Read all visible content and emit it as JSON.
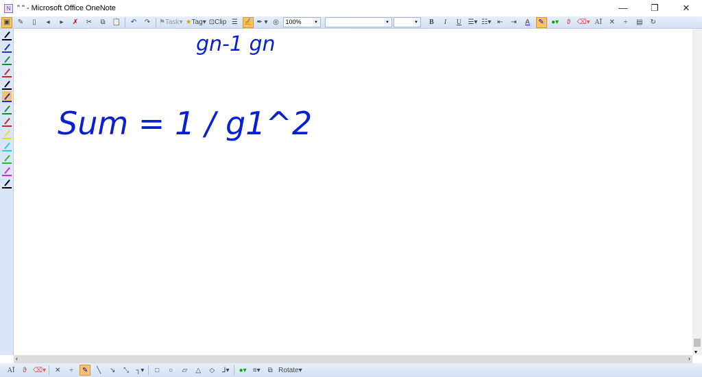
{
  "window": {
    "title": "\" \" - Microsoft Office OneNote",
    "minimize": "—",
    "restore": "❐",
    "close": "✕"
  },
  "toolbar": {
    "task_label": "Task",
    "tag_label": "Tag",
    "clip_label": "Clip",
    "zoom_value": "100%",
    "font_value": "",
    "size_value": "",
    "bold": "B",
    "italic": "I",
    "underline": "U",
    "font_color": "A",
    "text_style": "AĪ"
  },
  "drawing_toolbar": {
    "text_style": "AĪ",
    "rotate_label": "Rotate"
  },
  "pens": [
    {
      "color": "#000000"
    },
    {
      "color": "#1a30d0"
    },
    {
      "color": "#1a8a30"
    },
    {
      "color": "#d02020"
    },
    {
      "color": "#000000"
    },
    {
      "color": "#1a30d0",
      "active": true
    },
    {
      "color": "#1a8a30"
    },
    {
      "color": "#d02020"
    },
    {
      "color": "#e8e020"
    },
    {
      "color": "#20d0e0"
    },
    {
      "color": "#20c020"
    },
    {
      "color": "#e020e0"
    },
    {
      "color": "#000000"
    }
  ],
  "page": {
    "ink_text": [
      "gn-1 gn",
      "Sum = 1 / g1^2"
    ]
  }
}
